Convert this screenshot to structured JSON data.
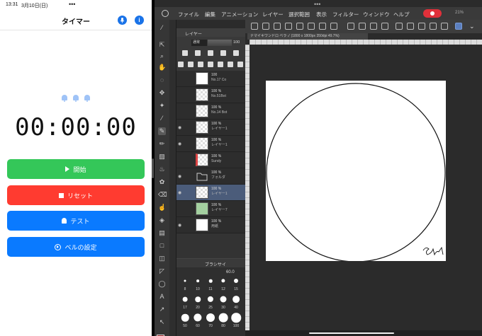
{
  "left_app": {
    "status": {
      "time": "13:31",
      "date": "3月10日(日)"
    },
    "title": "タイマー",
    "clock": "00:00:00",
    "buttons": {
      "start": "開始",
      "reset": "リセット",
      "test": "テスト",
      "bell_settings": "ベルの設定"
    },
    "colors": {
      "start": "#34c759",
      "reset": "#ff3b30",
      "primary": "#0a7aff"
    }
  },
  "right_app": {
    "menu": [
      "ファイル",
      "編集",
      "アニメーション",
      "レイヤー",
      "選択範囲",
      "表示",
      "フィルター",
      "ウィンドウ",
      "ヘルプ"
    ],
    "battery": "21%",
    "doc_tab": "ナマイキワンドロ ベラ ✓ (1800 x 1800px 350dpi 49.7%)",
    "layer_panel": {
      "tab": "レイヤー",
      "blend_mode": "通常",
      "opacity": "100",
      "layers": [
        {
          "opacity": "100",
          "name": "No.17 Co"
        },
        {
          "opacity": "100 %",
          "name": "No.51Bot"
        },
        {
          "opacity": "100 %",
          "name": "No.14 Bot"
        },
        {
          "opacity": "100 %",
          "name": "レイヤー1"
        },
        {
          "opacity": "100 %",
          "name": "レイヤー1"
        },
        {
          "opacity": "100 %",
          "name": "Sundy"
        },
        {
          "opacity": "100 %",
          "name": "フォルダ"
        },
        {
          "opacity": "100 %",
          "name": "レイヤー1"
        },
        {
          "opacity": "100 %",
          "name": "レイヤー7"
        },
        {
          "opacity": "100 %",
          "name": "用紙"
        }
      ]
    },
    "brush_panel": {
      "tab": "ブラシサイ",
      "size_value": "60.0",
      "sizes": [
        "8",
        "10",
        "11",
        "12",
        "15",
        "17",
        "20",
        "25",
        "30",
        "40",
        "50",
        "60",
        "70",
        "80",
        "100"
      ]
    },
    "signature": "Sunst"
  }
}
